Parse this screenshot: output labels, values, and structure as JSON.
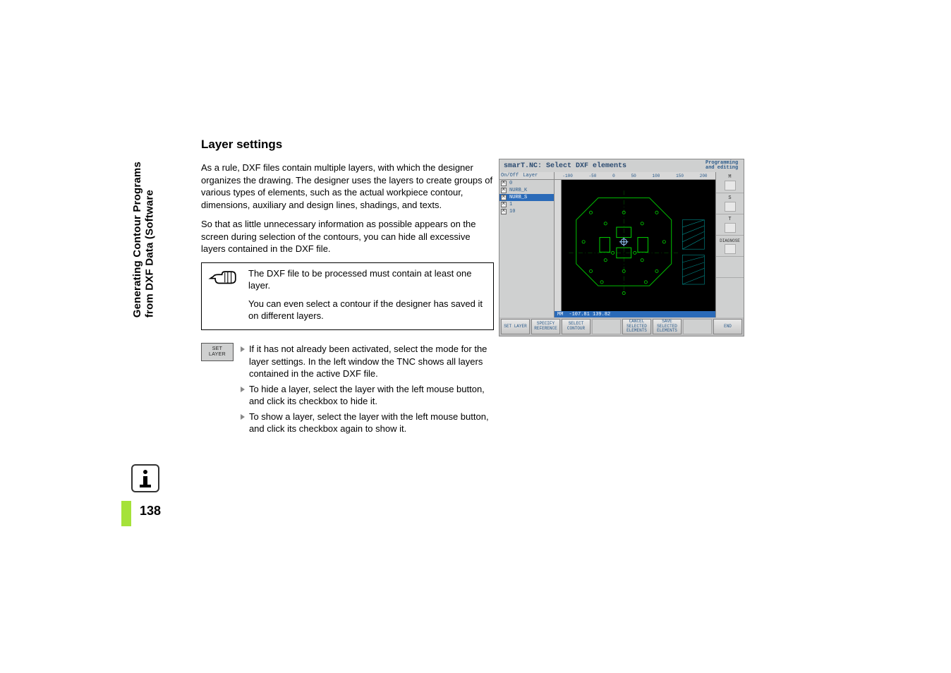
{
  "sidebar_title_line1": "Generating Contour Programs",
  "sidebar_title_line2": "from DXF Data (Software",
  "heading": "Layer settings",
  "para1": "As a rule, DXF files contain multiple layers, with which the designer organizes the drawing. The designer uses the layers to create groups of various types of elements, such as the actual workpiece contour, dimensions, auxiliary and design lines, shadings, and texts.",
  "para2": "So that as little unnecessary information as possible appears on the screen during selection of the contours, you can hide all excessive layers contained in the DXF file.",
  "note_p1": "The DXF file to be processed must contain at least one layer.",
  "note_p2": "You can even select a contour if the designer has saved it on different layers.",
  "soft_key": {
    "line1": "SET",
    "line2": "LAYER"
  },
  "bullets": [
    "If it has not already been activated, select the mode for the layer settings. In the left window the TNC shows all layers contained in the active DXF file.",
    "To hide a layer, select the layer with the left mouse button, and click its checkbox to hide it.",
    "To show a layer, select the layer with the left mouse button, and click its checkbox again to show it."
  ],
  "screenshot": {
    "title": "smarT.NC: Select DXF elements",
    "mode": "Programming and editing",
    "layer_head_onoff": "On/Off",
    "layer_head_layer": "Layer",
    "layers": [
      {
        "on": true,
        "name": "0",
        "sel": false
      },
      {
        "on": true,
        "name": "NURB_K",
        "sel": false
      },
      {
        "on": true,
        "name": "NURB_S",
        "sel": true
      },
      {
        "on": true,
        "name": "1",
        "sel": false
      },
      {
        "on": true,
        "name": "10",
        "sel": false
      }
    ],
    "ruler": [
      "-100",
      "-50",
      "0",
      "50",
      "100",
      "150",
      "200"
    ],
    "status_mm": "MM",
    "status_coord": "-107.81 139.82",
    "right_buttons": [
      "M",
      "S",
      "T",
      "DIAGNOSE",
      ""
    ],
    "softkeys": [
      "SET LAYER",
      "SPECIFY REFERENCE",
      "SELECT CONTOUR",
      "",
      "CANCEL SELECTED ELEMENTS",
      "SAVE SELECTED ELEMENTS",
      "",
      "END"
    ]
  },
  "page_number": "138"
}
